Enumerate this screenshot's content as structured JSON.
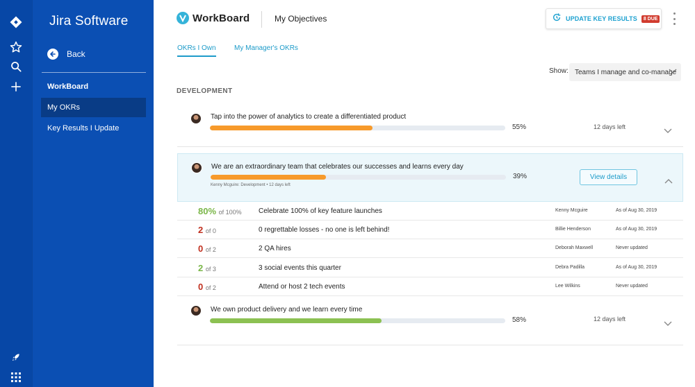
{
  "nav_rail": {
    "icons": [
      "jira-logo-icon",
      "star-icon",
      "search-icon",
      "plus-icon",
      "rocket-icon",
      "app-switcher-icon"
    ]
  },
  "sidebar": {
    "title": "Jira Software",
    "back_label": "Back",
    "items": [
      {
        "label": "WorkBoard",
        "active": false
      },
      {
        "label": "My OKRs",
        "active": true
      },
      {
        "label": "Key Results I Update",
        "active": false
      }
    ]
  },
  "header": {
    "logo_text": "WorkBoard",
    "title": "My Objectives",
    "update_button": {
      "label": "UPDATE KEY RESULTS",
      "badge": "8 DUE"
    }
  },
  "tabs": [
    {
      "label": "OKRs I Own",
      "active": true
    },
    {
      "label": "My Manager's OKRs",
      "active": false
    }
  ],
  "filter": {
    "label": "Show:",
    "value": "Teams I manage and co-manage"
  },
  "section_title": "DEVELOPMENT",
  "objectives": [
    {
      "title": "Tap into the power of analytics to create a differentiated product",
      "progress": 55,
      "progress_label": "55%",
      "color": "#f79a2b",
      "due": "12 days left",
      "expanded": false
    },
    {
      "title": "We are an extraordinary team that celebrates our successes and learns every day",
      "progress": 39,
      "progress_label": "39%",
      "color": "#f79a2b",
      "meta": "Kenny Mcguire: Development  •  12 days left",
      "view_details": "View details",
      "expanded": true,
      "key_results": [
        {
          "value": "80%",
          "of": "of 100%",
          "status": "green",
          "title": "Celebrate 100% of key feature launches",
          "owner": "Kenny Mcguire",
          "updated": "As of Aug 30, 2019"
        },
        {
          "value": "2",
          "of": "of 0",
          "status": "red",
          "title": "0 regrettable losses - no one is left behind!",
          "owner": "Billie Henderson",
          "updated": "As of Aug 30, 2019"
        },
        {
          "value": "0",
          "of": "of 2",
          "status": "red",
          "title": "2 QA hires",
          "owner": "Deborah Maxwell",
          "updated": "Never updated"
        },
        {
          "value": "2",
          "of": "of 3",
          "status": "green",
          "title": "3 social events this quarter",
          "owner": "Debra Padilla",
          "updated": "As of Aug 30, 2019"
        },
        {
          "value": "0",
          "of": "of 2",
          "status": "red",
          "title": "Attend or host 2 tech events",
          "owner": "Lee Wilkins",
          "updated": "Never updated"
        }
      ]
    },
    {
      "title": "We own product delivery and we learn every time",
      "progress": 58,
      "progress_label": "58%",
      "color": "#8cc152",
      "due": "12 days left",
      "expanded": false
    }
  ],
  "colors": {
    "rail": "#0747a6",
    "sidebar": "#0b4fb3",
    "accent": "#1d9bc9",
    "orange": "#f79a2b",
    "green": "#8cc152",
    "due_badge": "#d13c2f"
  }
}
